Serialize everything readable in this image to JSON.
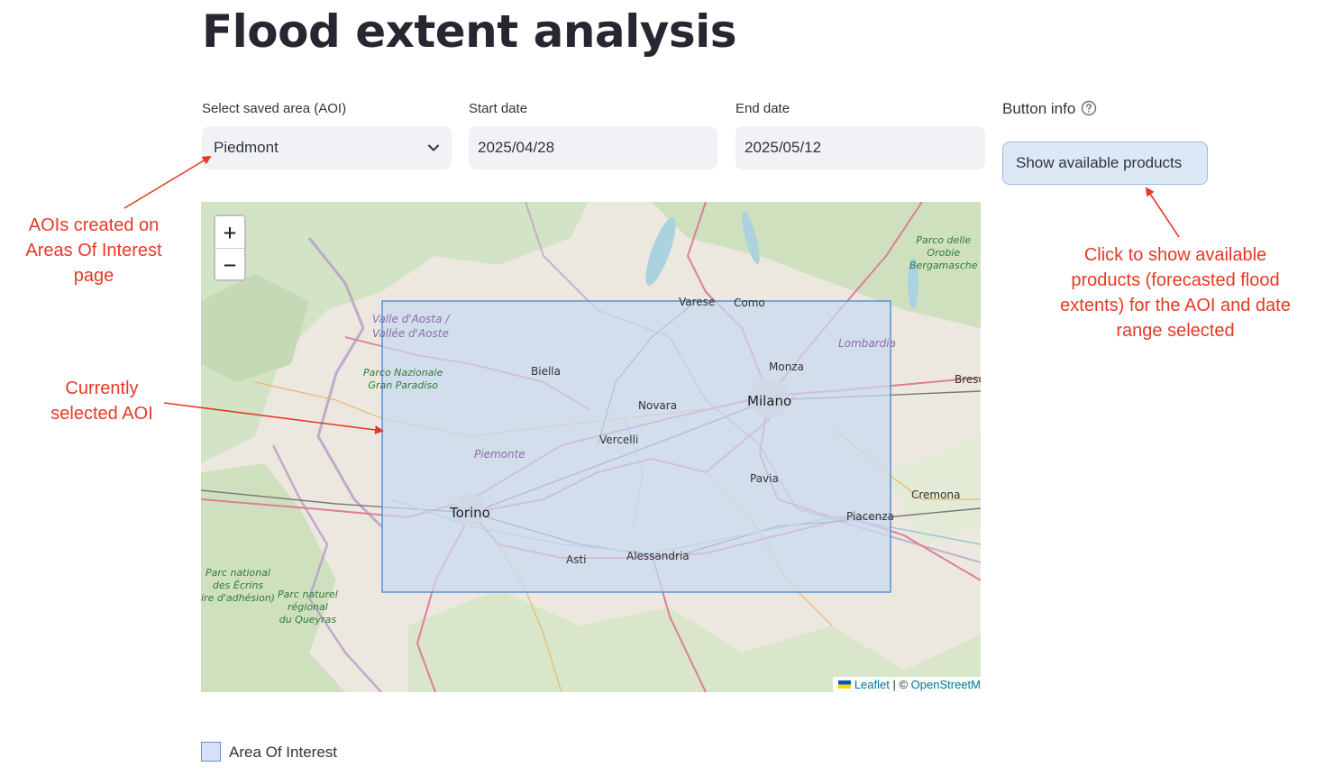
{
  "page_title": "Flood extent analysis",
  "filters": {
    "aoi_label": "Select saved area (AOI)",
    "aoi_value": "Piedmont",
    "start_label": "Start date",
    "start_value": "2025/04/28",
    "end_label": "End date",
    "end_value": "2025/05/12"
  },
  "button_info": {
    "label": "Button info",
    "button_label": "Show available products"
  },
  "map": {
    "zoom_in": "+",
    "zoom_out": "−",
    "attribution_leaflet": "Leaflet",
    "attribution_sep": " | © ",
    "attribution_osm": "OpenStreetM",
    "labels": {
      "torino": "Torino",
      "milano": "Milano",
      "novara": "Novara",
      "vercelli": "Vercelli",
      "biella": "Biella",
      "monza": "Monza",
      "pavia": "Pavia",
      "asti": "Asti",
      "alessandria": "Alessandria",
      "piacenza": "Piacenza",
      "cremona": "Cremona",
      "varese": "Varese",
      "como": "Como",
      "bresc": "Bresc",
      "piemonte": "Piemonte",
      "lombardia": "Lombardia",
      "valle_aosta": "Valle d'Aosta /",
      "vallee_aoste": "Vallée d'Aoste",
      "gran_paradiso_1": "Parco Nazionale",
      "gran_paradiso_2": "Gran Paradiso",
      "orobie_1": "Parco delle",
      "orobie_2": "Orobie",
      "orobie_3": "Bergamasche",
      "ecrins_1": "Parc national",
      "ecrins_2": "des Écrins",
      "ecrins_3": "ire d'adhésion)",
      "queyras_1": "Parc naturel",
      "queyras_2": "régional",
      "queyras_3": "du Queyras"
    }
  },
  "legend": {
    "label": "Area Of Interest"
  },
  "annotations": {
    "aoi_created": "AOIs created on Areas Of Interest page",
    "current_aoi": "Currently selected AOI",
    "show_products": "Click to show available products (forecasted flood extents) for the AOI and date range selected"
  },
  "colors": {
    "annotation": "#e53925",
    "aoi_fill": "#c9d9f2",
    "aoi_stroke": "#5a8fd6",
    "button_bg": "#dce8f5"
  },
  "icons": {
    "dropdown": "chevron-down-icon",
    "help": "question-circle-icon",
    "flag": "ukraine-flag-icon"
  }
}
